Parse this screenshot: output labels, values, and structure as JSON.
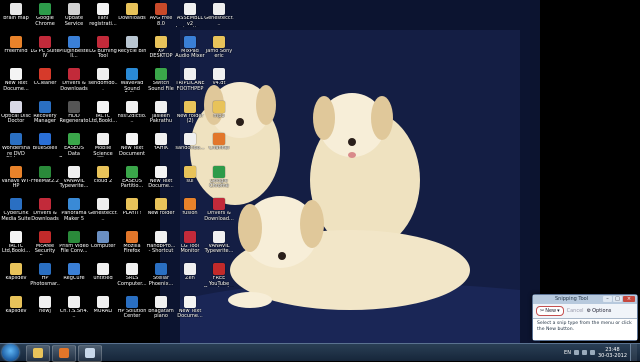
{
  "desktop": {
    "icons": [
      {
        "label": "brain map",
        "icon": "generic-app-icon",
        "color": "#e6e6e6"
      },
      {
        "label": "Google Chrome",
        "icon": "chrome-icon",
        "color": "#2d9b4a"
      },
      {
        "label": "Update Service",
        "icon": "update-icon",
        "color": "#d0d0d0"
      },
      {
        "label": "llanl registrati...",
        "icon": "document-icon",
        "color": "#f2f2f2"
      },
      {
        "label": "Downloads",
        "icon": "folder-icon",
        "color": "#e8c35a"
      },
      {
        "label": "AVG Free 8.0",
        "icon": "avg-icon",
        "color": "#c94a2a"
      },
      {
        "label": "ASSEMBLL v2 Instructio...",
        "icon": "document-icon",
        "color": "#f0f0f0"
      },
      {
        "label": "Genesteccr...",
        "icon": "document-icon",
        "color": "#eeeeee"
      },
      {
        "label": "Freemind",
        "icon": "freemind-icon",
        "color": "#e8822a"
      },
      {
        "label": "LG PC Suite IV",
        "icon": "lg-icon",
        "color": "#c22a3a"
      },
      {
        "label": "PluginBestell...",
        "icon": "plugin-icon",
        "color": "#3a7fd6"
      },
      {
        "label": "LG Burning Tool",
        "icon": "lg-icon",
        "color": "#c22a3a"
      },
      {
        "label": "Recycle Bin",
        "icon": "recycle-bin-icon",
        "color": "#b9c6d2"
      },
      {
        "label": "XP DESKTOP",
        "icon": "folder-icon",
        "color": "#e8c35a"
      },
      {
        "label": "MixPad Audio Mixer",
        "icon": "mixpad-icon",
        "color": "#3a7fd6"
      },
      {
        "label": "Jamo Sony eric",
        "icon": "folder-icon",
        "color": "#e8c35a"
      },
      {
        "label": "New Text Docume...",
        "icon": "text-file-icon",
        "color": "#f4f4f4"
      },
      {
        "label": "CCleaner",
        "icon": "ccleaner-icon",
        "color": "#d63a2a"
      },
      {
        "label": "Drivers & Downloads",
        "icon": "drivers-icon",
        "color": "#c22a3a"
      },
      {
        "label": "sendomdo...",
        "icon": "document-icon",
        "color": "#f0f0f0"
      },
      {
        "label": "WavePad Sound Editor",
        "icon": "wavepad-icon",
        "color": "#2a8ad6"
      },
      {
        "label": "Switch Sound File",
        "icon": "switch-icon",
        "color": "#3aa64a"
      },
      {
        "label": "TRIPLICANE FOOTHPEP",
        "icon": "document-icon",
        "color": "#f0f0f0"
      },
      {
        "label": "v4.dt",
        "icon": "document-icon",
        "color": "#f0f0f0"
      },
      {
        "label": "Optical Disc Doctor",
        "icon": "disc-icon",
        "color": "#d9d9e6"
      },
      {
        "label": "Recovery Manager",
        "icon": "recovery-icon",
        "color": "#2a6fc2"
      },
      {
        "label": "HDD Regenerator",
        "icon": "hdd-icon",
        "color": "#555555"
      },
      {
        "label": "IRCTC Ltd,Booki...",
        "icon": "web-shortcut-icon",
        "color": "#f4f4f4"
      },
      {
        "label": "hss!2dictio...",
        "icon": "document-icon",
        "color": "#f0f0f0"
      },
      {
        "label": "Jasleen Pakrathu",
        "icon": "document-icon",
        "color": "#f0f0f0"
      },
      {
        "label": "New folder (2)",
        "icon": "folder-icon",
        "color": "#e8c35a"
      },
      {
        "label": "mp3",
        "icon": "folder-icon",
        "color": "#e8c35a"
      },
      {
        "label": "Wondershare DVD Slides...",
        "icon": "dvd-icon",
        "color": "#2a6fc2"
      },
      {
        "label": "BlueSoleil",
        "icon": "bluetooth-icon",
        "color": "#2a6fd6"
      },
      {
        "label": "EASEUS Data Recovery ...",
        "icon": "easeus-icon",
        "color": "#3aa64a"
      },
      {
        "label": "Mobile Science Wi...",
        "icon": "document-icon",
        "color": "#f0f0f0"
      },
      {
        "label": "New Text Document",
        "icon": "text-file-icon",
        "color": "#f4f4f4"
      },
      {
        "label": "YAHIK",
        "icon": "document-icon",
        "color": "#f0f0f0"
      },
      {
        "label": "sandondo...",
        "icon": "document-icon",
        "color": "#f0f0f0"
      },
      {
        "label": "Channel",
        "icon": "firefox-icon",
        "color": "#e2762a"
      },
      {
        "label": "Vanavil WT-HP",
        "icon": "vanavil-icon",
        "color": "#e8822a"
      },
      {
        "label": "FreeMat2.2",
        "icon": "freemat-icon",
        "color": "#2a8a3a"
      },
      {
        "label": "VANAVIL Typewrite...",
        "icon": "document-icon",
        "color": "#f0f0f0"
      },
      {
        "label": "cloud 2",
        "icon": "folder-icon",
        "color": "#e8c35a"
      },
      {
        "label": "EASEUS Partitio...",
        "icon": "easeus-icon",
        "color": "#3aa64a"
      },
      {
        "label": "New Text Docume...",
        "icon": "text-file-icon",
        "color": "#f4f4f4"
      },
      {
        "label": "sui",
        "icon": "folder-icon",
        "color": "#e8c35a"
      },
      {
        "label": "Google Chrome",
        "icon": "chrome-icon",
        "color": "#2d9b4a"
      },
      {
        "label": "CyberLink Media Suite",
        "icon": "cyberlink-icon",
        "color": "#2a6fc2"
      },
      {
        "label": "Drivers & Downloads",
        "icon": "drivers-icon",
        "color": "#c22a3a"
      },
      {
        "label": "Panorama Maker 5",
        "icon": "panorama-icon",
        "color": "#3a8ad6"
      },
      {
        "label": "Genesteccr...",
        "icon": "document-icon",
        "color": "#eeeeee"
      },
      {
        "label": "PLAYIT!",
        "icon": "playit-icon",
        "color": "#e8c35a"
      },
      {
        "label": "New folder",
        "icon": "folder-icon",
        "color": "#e8c35a"
      },
      {
        "label": "fusion",
        "icon": "vlc-icon",
        "color": "#e8822a"
      },
      {
        "label": "Drivers & Download...",
        "icon": "drivers-icon",
        "color": "#c22a3a"
      },
      {
        "label": "IRCTC Ltd,Booki...",
        "icon": "web-shortcut-icon",
        "color": "#f4f4f4"
      },
      {
        "label": "McAfee Security Sc...",
        "icon": "mcafee-icon",
        "color": "#c22a2a"
      },
      {
        "label": "Prism Video File Conv...",
        "icon": "prism-icon",
        "color": "#2a8a3a"
      },
      {
        "label": "Computer",
        "icon": "computer-icon",
        "color": "#6a8fc2"
      },
      {
        "label": "Mozilla Firefox",
        "icon": "firefox-icon",
        "color": "#e2762a"
      },
      {
        "label": "HandbPro... - Shortcut",
        "icon": "shortcut-icon",
        "color": "#f0f0f0"
      },
      {
        "label": "LG Tool Monitor",
        "icon": "lg-icon",
        "color": "#c22a3a"
      },
      {
        "label": "VANAVIL Typewrite...",
        "icon": "document-icon",
        "color": "#f0f0f0"
      },
      {
        "label": "kapildev",
        "icon": "user-folder-icon",
        "color": "#e8c35a"
      },
      {
        "label": "HP Photosmar...",
        "icon": "hp-icon",
        "color": "#2a6fc2"
      },
      {
        "label": "RegCure",
        "icon": "regcure-icon",
        "color": "#3a7fd6"
      },
      {
        "label": "untitled",
        "icon": "document-icon",
        "color": "#f0f0f0"
      },
      {
        "label": "SRLS Computer...",
        "icon": "document-icon",
        "color": "#f0f0f0"
      },
      {
        "label": "Stellar Phoenix...",
        "icon": "stellar-icon",
        "color": "#2a6fc2"
      },
      {
        "label": "Zen",
        "icon": "document-icon",
        "color": "#f0f0f0"
      },
      {
        "label": "FREE YouTube Downloader",
        "icon": "youtube-downloader-icon",
        "color": "#c22a2a"
      },
      {
        "label": "kapildev",
        "icon": "user-folder-icon",
        "color": "#e8c35a"
      },
      {
        "label": "newj",
        "icon": "document-icon",
        "color": "#f0f0f0"
      },
      {
        "label": "Ch.T.S.Sri4...",
        "icon": "document-icon",
        "color": "#f0f0f0"
      },
      {
        "label": "MURALI",
        "icon": "document-icon",
        "color": "#f0f0f0"
      },
      {
        "label": "HP Solution Center",
        "icon": "hp-icon",
        "color": "#2a6fc2"
      },
      {
        "label": "bhagatam piano",
        "icon": "document-icon",
        "color": "#f0f0f0"
      },
      {
        "label": "New Text Docume...",
        "icon": "text-file-icon",
        "color": "#f4f4f4"
      }
    ]
  },
  "snipping_tool": {
    "title": "Snipping Tool",
    "new_label": "New",
    "cancel_label": "Cancel",
    "options_label": "Options",
    "message": "Select a snip type from the menu or click the New button."
  },
  "taskbar": {
    "pinned": [
      {
        "name": "explorer-icon",
        "color": "#e8c35a"
      },
      {
        "name": "firefox-icon",
        "color": "#e2762a"
      },
      {
        "name": "snipping-tool-icon",
        "color": "#c8d8ea"
      }
    ],
    "language": "EN",
    "time": "23:48",
    "date": "30-03-2012"
  }
}
